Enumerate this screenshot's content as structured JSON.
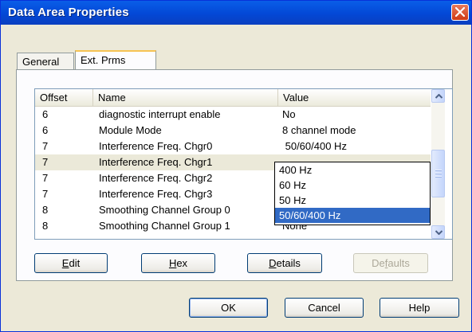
{
  "window": {
    "title": "Data Area Properties"
  },
  "tabs": [
    {
      "label": "General"
    },
    {
      "label": "Ext. Prms"
    }
  ],
  "table": {
    "headers": [
      "Offset",
      "Name",
      "Value"
    ],
    "rows": [
      {
        "offset": "6",
        "name": "diagnostic interrupt enable",
        "value": "No"
      },
      {
        "offset": "6",
        "name": "Module Mode",
        "value": "8 channel mode"
      },
      {
        "offset": "7",
        "name": "Interference Freq. Chgr0",
        "value": " 50/60/400 Hz"
      },
      {
        "offset": "7",
        "name": "Interference Freq. Chgr1",
        "value": ""
      },
      {
        "offset": "7",
        "name": "Interference Freq. Chgr2",
        "value": ""
      },
      {
        "offset": "7",
        "name": "Interference Freq. Chgr3",
        "value": ""
      },
      {
        "offset": "8",
        "name": "Smoothing Channel Group 0",
        "value": ""
      },
      {
        "offset": "8",
        "name": "Smoothing Channel Group 1",
        "value": "None"
      }
    ]
  },
  "dropdown": {
    "options": [
      "400 Hz",
      "60 Hz",
      "50 Hz",
      "50/60/400 Hz"
    ],
    "highlighted": "50/60/400 Hz"
  },
  "buttons": {
    "edit": {
      "pre": "",
      "key": "E",
      "post": "dit"
    },
    "hex": {
      "pre": "",
      "key": "H",
      "post": "ex"
    },
    "details": {
      "pre": "",
      "key": "D",
      "post": "etails"
    },
    "defaults": {
      "pre": "De",
      "key": "f",
      "post": "aults"
    },
    "ok": "OK",
    "cancel": "Cancel",
    "help": "Help"
  },
  "colors": {
    "titlebar": "#0348d6",
    "selection": "#316ac5",
    "dialog_bg": "#ece9d8"
  },
  "icons": [
    "close-icon",
    "scroll-up-icon",
    "scroll-down-icon"
  ]
}
